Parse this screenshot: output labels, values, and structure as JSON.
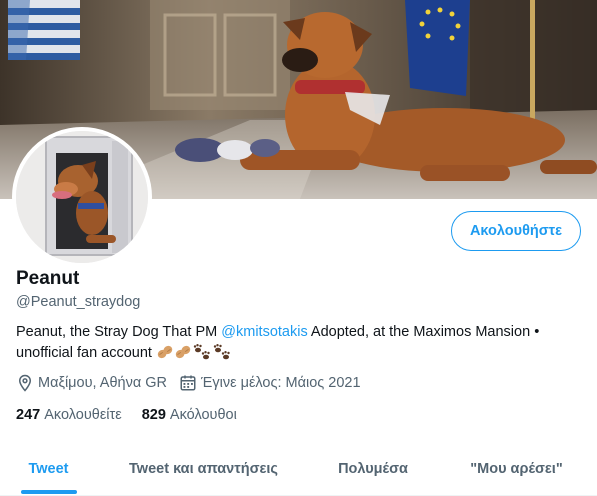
{
  "profile": {
    "display_name": "Peanut",
    "handle": "@Peanut_straydog",
    "bio_text_1": "Peanut, the Stray Dog That PM ",
    "bio_mention": "@kmitsotakis",
    "bio_text_2": " Adopted, at the Maximos Mansion • unofficial fan account ",
    "bio_emojis": [
      "peanut-emoji",
      "peanut-emoji",
      "paw-prints-emoji",
      "paw-prints-emoji"
    ],
    "location": "Μαξίμου, Αθήνα GR",
    "joined": "Έγινε μέλος: Μάιος 2021",
    "following_count": "247",
    "following_label": "Ακολουθείτε",
    "followers_count": "829",
    "followers_label": "Ακόλουθοι"
  },
  "actions": {
    "follow_label": "Ακολουθήστε"
  },
  "tabs": [
    {
      "label": "Tweet",
      "active": true
    },
    {
      "label": "Tweet και απαντήσεις",
      "active": false
    },
    {
      "label": "Πολυμέσα",
      "active": false
    },
    {
      "label": "\"Μου αρέσει\"",
      "active": false
    }
  ],
  "colors": {
    "accent": "#1d9bf0",
    "text_primary": "#0f1419",
    "text_secondary": "#536471"
  },
  "icons": {
    "location": "location-pin-icon",
    "joined": "calendar-icon"
  }
}
